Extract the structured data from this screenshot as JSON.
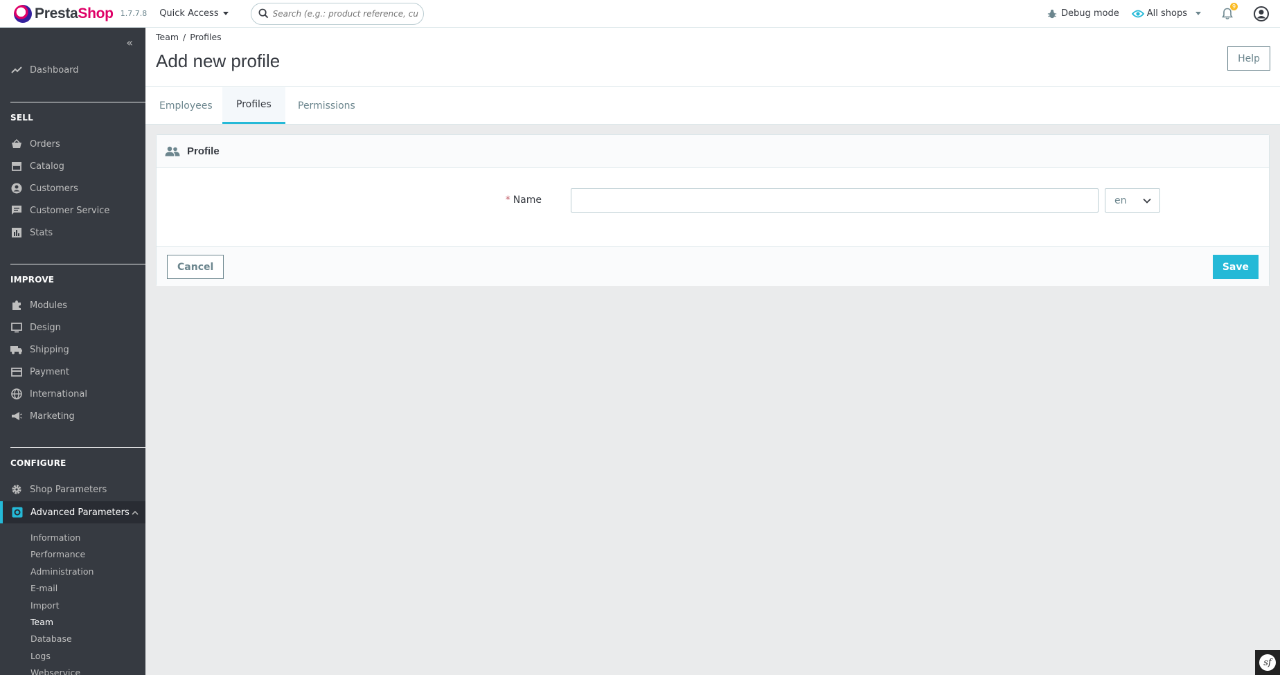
{
  "header": {
    "logo_prefix": "Presta",
    "logo_suffix": "Shop",
    "version": "1.7.7.8",
    "quick_access": "Quick Access",
    "search_placeholder": "Search (e.g.: product reference, customer name…)",
    "debug_mode": "Debug mode",
    "all_shops": "All shops",
    "notifications_count": "9"
  },
  "sidebar": {
    "dashboard": "Dashboard",
    "sections": {
      "sell": "SELL",
      "improve": "IMPROVE",
      "configure": "CONFIGURE"
    },
    "sell_items": [
      "Orders",
      "Catalog",
      "Customers",
      "Customer Service",
      "Stats"
    ],
    "improve_items": [
      "Modules",
      "Design",
      "Shipping",
      "Payment",
      "International",
      "Marketing"
    ],
    "configure_items": [
      "Shop Parameters",
      "Advanced Parameters"
    ],
    "sub_items": [
      "Information",
      "Performance",
      "Administration",
      "E-mail",
      "Import",
      "Team",
      "Database",
      "Logs",
      "Webservice"
    ],
    "current_sub_item": "Team"
  },
  "page": {
    "breadcrumb": [
      "Team",
      "Profiles"
    ],
    "title": "Add new profile",
    "help_label": "Help",
    "tabs": [
      "Employees",
      "Profiles",
      "Permissions"
    ],
    "active_tab": "Profiles"
  },
  "form": {
    "card_title": "Profile",
    "required_mark": "*",
    "name_label": "Name",
    "name_value": "",
    "language": "en",
    "cancel_label": "Cancel",
    "save_label": "Save"
  },
  "colors": {
    "accent": "#25b9d7",
    "sidebar_bg": "#363a41",
    "brand_pink": "#df0067",
    "badge": "#fbbb22"
  }
}
